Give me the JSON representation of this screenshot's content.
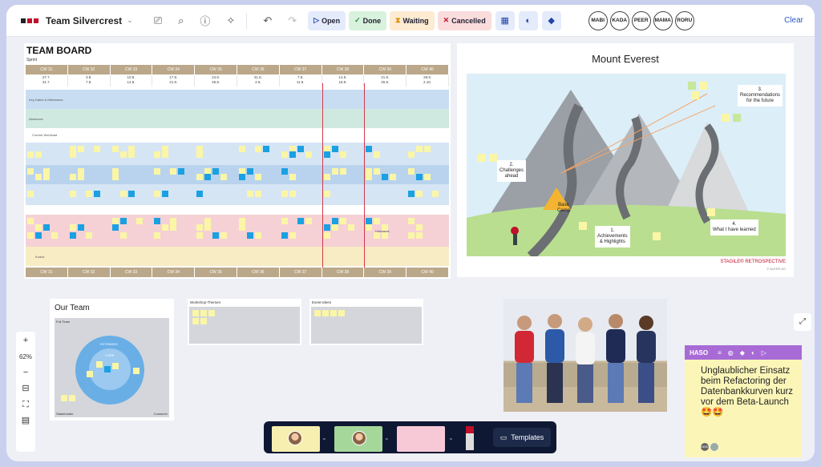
{
  "topbar": {
    "board_title": "Team Silvercrest",
    "filters": {
      "open": "Open",
      "done": "Done",
      "waiting": "Waiting",
      "cancelled": "Cancelled"
    },
    "avatars": [
      "MABI",
      "KADA",
      "PEER",
      "MAMA",
      "RORU"
    ],
    "clear_label": "Clear"
  },
  "team_board": {
    "title": "TEAM BOARD",
    "subtitle": "Sprint",
    "weeks": [
      "CW 31",
      "CW 32",
      "CW 33",
      "CW 34",
      "CW 35",
      "CW 36",
      "CW 37",
      "CW 38",
      "CW 39",
      "CW 40"
    ],
    "dates": [
      "27.7.\n31.7.",
      "3.8.\n7.8.",
      "10.8.\n14.8.",
      "17.8.\n21.8.",
      "24.8.\n28.8.",
      "31.8.\n4.9.",
      "7.9.\n11.9.",
      "14.9.\n18.9.",
      "21.9.\n25.9.",
      "28.9.\n2.10."
    ],
    "band_labels": {
      "milestones": "Key Dates & Milestones",
      "absences": "Absences",
      "workload": "Current Workload",
      "highlights": "Highlights",
      "kudos": "Kudos"
    }
  },
  "everest": {
    "title": "Mount Everest",
    "labels": {
      "recommendations": "3.\nRecommendations\nfor the future",
      "challenges": "2.\nChallenges\nahead",
      "base_camp": "Base\nCamp",
      "achievements": "1.\nAchievements\n& Highlights",
      "learned": "4.\nWhat I have learned"
    },
    "footer": "STAGILE® RETROSPECTIVE",
    "footer_small": "© ALERS AG"
  },
  "our_team": {
    "title": "Our Team",
    "full_team": "Full Team",
    "extended": "EXTENDED",
    "core": "CORE",
    "stakeholder": "Stakeholder",
    "customer": "Customer"
  },
  "workshop": {
    "title": "Workshop-Themen"
  },
  "event": {
    "title": "Event-Ideen"
  },
  "zoom": {
    "plus": "+",
    "value": "62%",
    "minus": "−"
  },
  "haso_note": {
    "author": "HASO",
    "text": "Unglaublicher Einsatz beim Refactoring der Datenbankkurven kurz vor dem Beta-Launch 🤩🤩",
    "footer_tag": "HASO"
  },
  "bottom_toolbar": {
    "templates_label": "Templates"
  },
  "colors": {
    "accent": "#2a59c8",
    "brand": "#c0102a",
    "sticky_yellow": "#fbf6a6",
    "haso_purple": "#a86bd6"
  }
}
